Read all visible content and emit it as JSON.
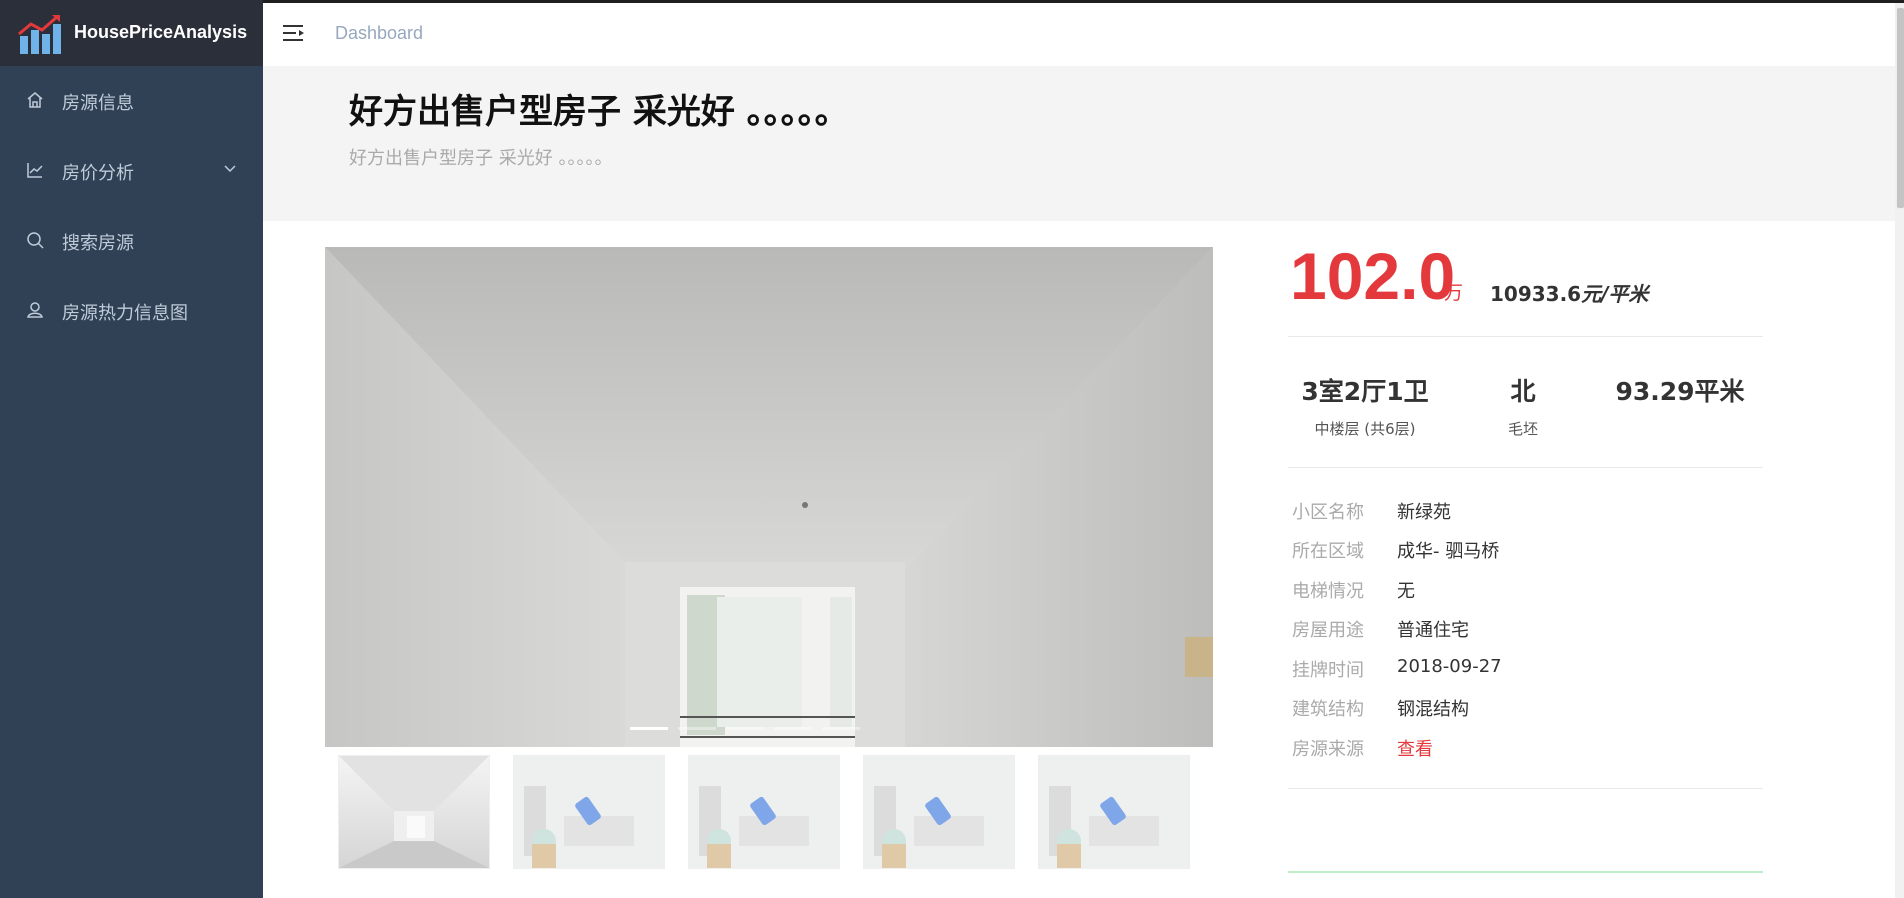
{
  "app": {
    "name": "HousePriceAnalysis"
  },
  "sidebar": {
    "items": [
      {
        "label": "房源信息",
        "icon": "home-icon"
      },
      {
        "label": "房价分析",
        "icon": "line-chart-icon",
        "expandable": true
      },
      {
        "label": "搜索房源",
        "icon": "search-icon"
      },
      {
        "label": "房源热力信息图",
        "icon": "map-user-icon"
      }
    ]
  },
  "header": {
    "breadcrumb": "Dashboard"
  },
  "listing": {
    "title": "好方出售户型房子 采光好 。。。。。",
    "subtitle": "好方出售户型房子 采光好 。。。。。",
    "price": "102.0",
    "price_unit": "万",
    "unit_price_value": "10933.6",
    "unit_price_unit": "元/平米",
    "layout": {
      "value": "3室2厅1卫",
      "sub": "中楼层 (共6层)"
    },
    "orientation": {
      "value": "北",
      "sub": "毛坯"
    },
    "area": {
      "value": "93.29平米"
    },
    "details": [
      {
        "key": "小区名称",
        "value": "新绿苑"
      },
      {
        "key": "所在区域",
        "value": "成华- 驷马桥"
      },
      {
        "key": "电梯情况",
        "value": "无"
      },
      {
        "key": "房屋用途",
        "value": "普通住宅"
      },
      {
        "key": "挂牌时间",
        "value": "2018-09-27"
      },
      {
        "key": "建筑结构",
        "value": "钢混结构"
      },
      {
        "key": "房源来源",
        "value": "查看",
        "link": true
      }
    ]
  },
  "gallery": {
    "thumbnail_count": 5,
    "active_index": 0
  },
  "colors": {
    "sidebar": "#304156",
    "brand_bar": "#2b2f3a",
    "accent_red": "#e4393c",
    "menu_text": "#bfcbd9"
  }
}
